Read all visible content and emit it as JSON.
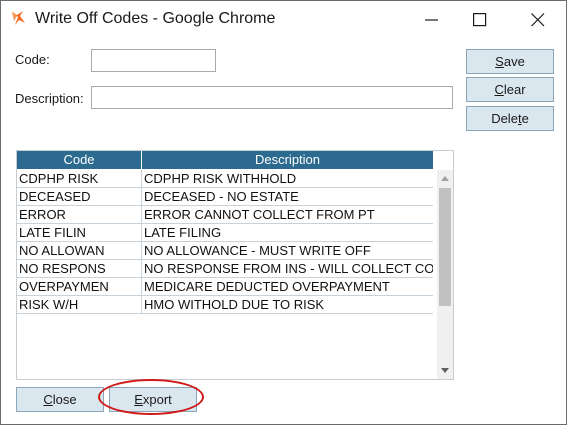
{
  "window": {
    "title": "Write Off Codes - Google Chrome",
    "icon": "chrome-app-icon"
  },
  "form": {
    "code_label": "Code:",
    "code_value": "",
    "description_label": "Description:",
    "description_value": ""
  },
  "buttons": {
    "save_pre": "",
    "save_ul": "S",
    "save_post": "ave",
    "clear_pre": "",
    "clear_ul": "C",
    "clear_post": "lear",
    "delete_pre": "Dele",
    "delete_ul": "t",
    "delete_post": "e",
    "close_pre": "",
    "close_ul": "C",
    "close_post": "lose",
    "export_pre": "",
    "export_ul": "E",
    "export_post": "xport"
  },
  "table": {
    "columns": [
      "Code",
      "Description"
    ],
    "rows": [
      {
        "code": "CDPHP RISK",
        "description": "CDPHP RISK WITHHOLD"
      },
      {
        "code": "DECEASED",
        "description": "DECEASED - NO ESTATE"
      },
      {
        "code": "ERROR",
        "description": "ERROR CANNOT COLLECT FROM PT"
      },
      {
        "code": "LATE FILIN",
        "description": "LATE FILING"
      },
      {
        "code": "NO ALLOWAN",
        "description": "NO ALLOWANCE - MUST WRITE OFF"
      },
      {
        "code": "NO RESPONS",
        "description": "NO RESPONSE FROM INS - WILL COLLECT CO"
      },
      {
        "code": "OVERPAYMEN",
        "description": "MEDICARE DEDUCTED OVERPAYMENT"
      },
      {
        "code": "RISK W/H",
        "description": "HMO WITHOLD DUE TO RISK"
      }
    ]
  },
  "colors": {
    "header_bg": "#2c6a8f",
    "button_bg": "#dbe7ef",
    "highlight": "#d01818",
    "app_icon": "#f26b21"
  }
}
